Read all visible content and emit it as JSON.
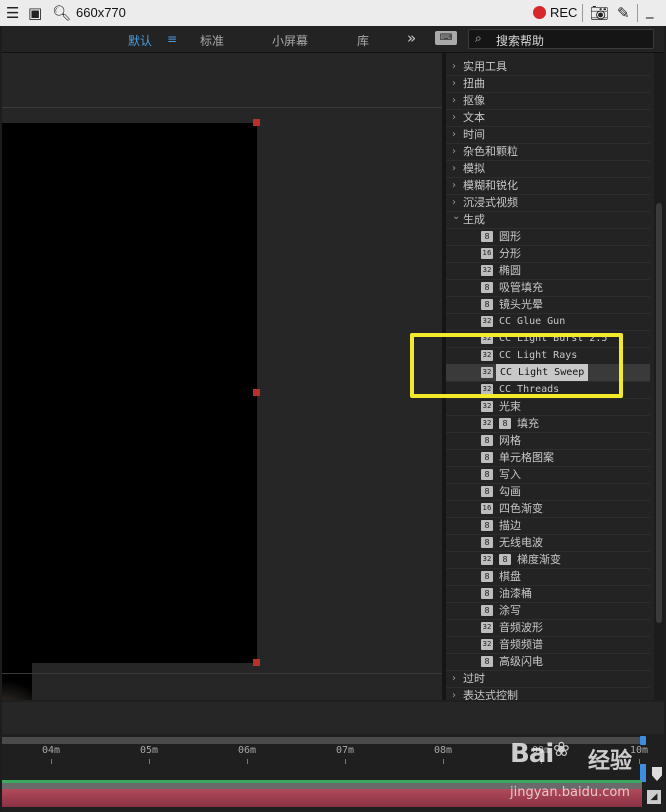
{
  "capture_bar": {
    "title": "660x770",
    "rec_label": "REC",
    "icons": [
      "menu-icon",
      "window-icon",
      "search-icon",
      "record-dot-icon",
      "camera-icon",
      "pencil-icon",
      "minimize-icon"
    ],
    "rec_color": "#d8262a"
  },
  "workspace": {
    "tabs": [
      {
        "label": "默认",
        "active": true
      },
      {
        "label": "标准",
        "active": false
      },
      {
        "label": "小屏幕",
        "active": false
      },
      {
        "label": "库",
        "active": false
      }
    ],
    "menu_glyph": "≡",
    "more_glyph": "»",
    "search_placeholder": "搜索帮助",
    "accent": "#4a9de0"
  },
  "effects_panel": {
    "categories_top": [
      "实用工具",
      "扭曲",
      "抠像",
      "文本",
      "时间",
      "杂色和颗粒",
      "模拟",
      "模糊和锐化",
      "沉浸式视频"
    ],
    "expanded_category": "生成",
    "effects": [
      {
        "badge": "8",
        "extra": "",
        "name": "圆形"
      },
      {
        "badge": "16",
        "extra": "",
        "name": "分形"
      },
      {
        "badge": "32",
        "extra": "",
        "name": "椭圆"
      },
      {
        "badge": "8",
        "extra": "",
        "name": "吸管填充"
      },
      {
        "badge": "8",
        "extra": "",
        "name": "镜头光晕"
      },
      {
        "badge": "32",
        "extra": "",
        "name": "CC Glue Gun"
      },
      {
        "badge": "32",
        "extra": "",
        "name": "CC Light Burst 2.5"
      },
      {
        "badge": "32",
        "extra": "",
        "name": "CC Light Rays"
      },
      {
        "badge": "32",
        "extra": "",
        "name": "CC Light Sweep",
        "selected": true
      },
      {
        "badge": "32",
        "extra": "",
        "name": "CC Threads"
      },
      {
        "badge": "32",
        "extra": "",
        "name": "光束"
      },
      {
        "badge": "32",
        "extra": "8",
        "name": "填充"
      },
      {
        "badge": "8",
        "extra": "",
        "name": "网格"
      },
      {
        "badge": "8",
        "extra": "",
        "name": "单元格图案"
      },
      {
        "badge": "8",
        "extra": "",
        "name": "写入"
      },
      {
        "badge": "8",
        "extra": "",
        "name": "勾画"
      },
      {
        "badge": "16",
        "extra": "",
        "name": "四色渐变"
      },
      {
        "badge": "8",
        "extra": "",
        "name": "描边"
      },
      {
        "badge": "8",
        "extra": "",
        "name": "无线电波"
      },
      {
        "badge": "32",
        "extra": "8",
        "name": "梯度渐变"
      },
      {
        "badge": "8",
        "extra": "",
        "name": "棋盘"
      },
      {
        "badge": "8",
        "extra": "",
        "name": "油漆桶"
      },
      {
        "badge": "8",
        "extra": "",
        "name": "涂写"
      },
      {
        "badge": "32",
        "extra": "",
        "name": "音频波形"
      },
      {
        "badge": "32",
        "extra": "",
        "name": "音频频谱"
      },
      {
        "badge": "8",
        "extra": "",
        "name": "高级闪电"
      }
    ],
    "categories_bottom": [
      "过时",
      "表达式控制"
    ]
  },
  "timeline": {
    "ticks": [
      "04m",
      "05m",
      "06m",
      "07m",
      "08m",
      "09m",
      "10m"
    ]
  },
  "watermark": {
    "logo": "Bai",
    "logo_tail": "经验",
    "url": "jingyan.baidu.com"
  }
}
